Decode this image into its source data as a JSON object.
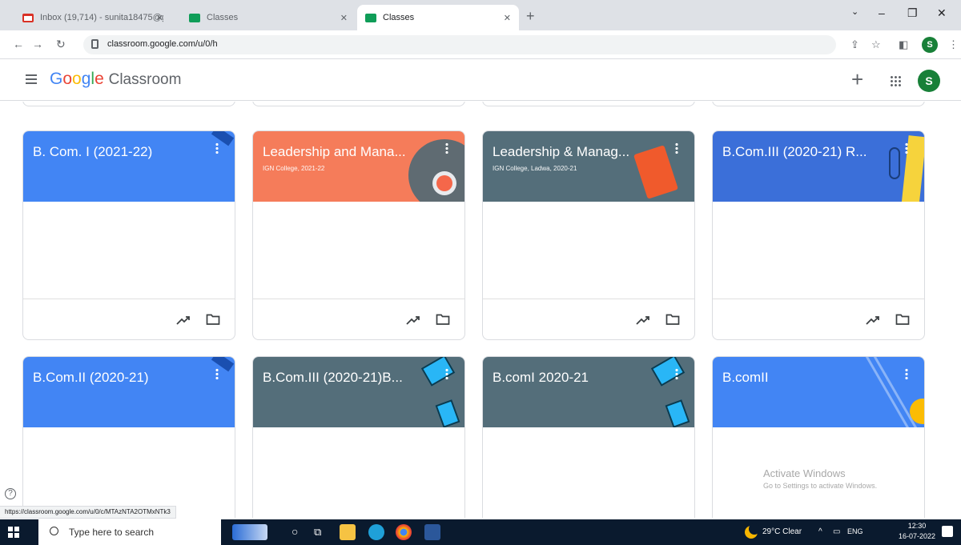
{
  "colors": {
    "blue": "#4285f4",
    "orange": "#f57c5a",
    "slate": "#546e7a",
    "green": "#188038"
  },
  "browser": {
    "tabs": [
      {
        "title": "Inbox (19,714) - sunita18475@g",
        "active": false,
        "icon": "gmail-icon"
      },
      {
        "title": "Classes",
        "active": false,
        "icon": "classroom-icon"
      },
      {
        "title": "Classes",
        "active": true,
        "icon": "classroom-icon"
      }
    ],
    "url": "classroom.google.com/u/0/h",
    "profile_initial": "S"
  },
  "appbar": {
    "brand_google": [
      "G",
      "o",
      "o",
      "g",
      "l",
      "e"
    ],
    "brand_product": "Classroom",
    "avatar_initial": "S"
  },
  "cards": [
    {
      "title": "B. Com. I (2021-22)",
      "subtitle": "",
      "color": "#4285f4",
      "theme": "pen"
    },
    {
      "title": "Leadership and Mana...",
      "subtitle": "IGN College, 2021-22",
      "color": "#f57c5a",
      "theme": "circles"
    },
    {
      "title": "Leadership & Manag...",
      "subtitle": "IGN College, Ladwa, 2020-21",
      "color": "#546e7a",
      "theme": "book"
    },
    {
      "title": "B.Com.III (2020-21) R...",
      "subtitle": "",
      "color": "#3b6fd9",
      "theme": "ruler"
    },
    {
      "title": "B.Com.II (2020-21)",
      "subtitle": "",
      "color": "#4285f4",
      "theme": "pen"
    },
    {
      "title": "B.Com.III (2020-21)B...",
      "subtitle": "",
      "color": "#546e7a",
      "theme": "devices"
    },
    {
      "title": "B.comI 2020-21",
      "subtitle": "",
      "color": "#546e7a",
      "theme": "devices"
    },
    {
      "title": "B.comII",
      "subtitle": "",
      "color": "#4285f4",
      "theme": "lines"
    }
  ],
  "status_url": "https://classroom.google.com/u/0/c/MTAzNTA2OTMxNTk3",
  "watermark": {
    "line1": "Activate Windows",
    "line2": "Go to Settings to activate Windows."
  },
  "taskbar": {
    "search_placeholder": "Type here to search",
    "weather": "29°C Clear",
    "lang": "ENG",
    "time": "12:30",
    "date": "16-07-2022"
  }
}
